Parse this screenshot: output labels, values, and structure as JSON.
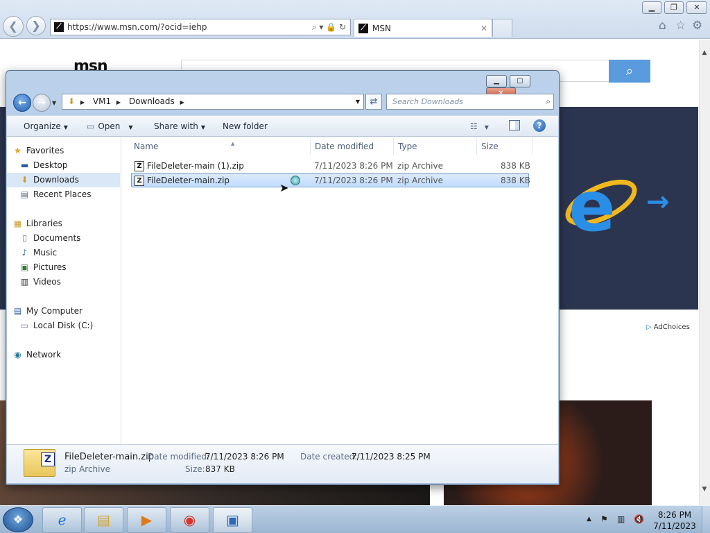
{
  "browser": {
    "url": "https://www.msn.com/?ocid=iehp",
    "tab_title": "MSN",
    "favicon": "msn-icon",
    "window_controls": {
      "minimize": "minimize-icon",
      "restore": "restore-icon",
      "close": "close-icon"
    },
    "toolbar_icons": [
      "home-icon",
      "star-icon",
      "gear-icon"
    ]
  },
  "msn_page": {
    "logo_text": "msn",
    "ad_choices": "AdChoices"
  },
  "explorer": {
    "breadcrumb": [
      "VM1",
      "Downloads"
    ],
    "search_placeholder": "Search Downloads",
    "toolbar": {
      "organize": "Organize",
      "open": "Open",
      "share_with": "Share with",
      "new_folder": "New folder"
    },
    "nav": {
      "favorites": "Favorites",
      "desktop": "Desktop",
      "downloads": "Downloads",
      "recent_places": "Recent Places",
      "libraries": "Libraries",
      "documents": "Documents",
      "music": "Music",
      "pictures": "Pictures",
      "videos": "Videos",
      "my_computer": "My Computer",
      "local_disk": "Local Disk (C:)",
      "network": "Network"
    },
    "columns": {
      "name": "Name",
      "date": "Date modified",
      "type": "Type",
      "size": "Size"
    },
    "files": [
      {
        "name": "FileDeleter-main (1).zip",
        "date": "7/11/2023 8:26 PM",
        "type": "zip Archive",
        "size": "838 KB"
      },
      {
        "name": "FileDeleter-main.zip",
        "date": "7/11/2023 8:26 PM",
        "type": "zip Archive",
        "size": "838 KB"
      }
    ],
    "details": {
      "name": "FileDeleter-main.zip",
      "type": "zip Archive",
      "modified_label": "Date modified:",
      "modified": "7/11/2023 8:26 PM",
      "size_label": "Size:",
      "size": "837 KB",
      "created_label": "Date created:",
      "created": "7/11/2023 8:25 PM"
    }
  },
  "taskbar": {
    "time": "8:26 PM",
    "date": "7/11/2023",
    "apps": [
      "internet-explorer-icon",
      "file-explorer-icon",
      "media-player-icon",
      "chrome-icon",
      "image-viewer-icon"
    ]
  },
  "colors": {
    "accent": "#5a9be0",
    "banner": "#2b3550",
    "selection": "#c1dbfc"
  }
}
